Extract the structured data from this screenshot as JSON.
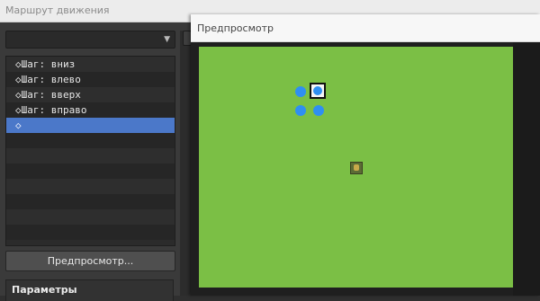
{
  "main_window": {
    "title": "Маршрут движения",
    "combo": {
      "value": "",
      "arrow": "▼"
    },
    "commands": [
      "◇Шаг: вниз",
      "◇Шаг: влево",
      "◇Шаг: вверх",
      "◇Шаг: вправо",
      "◇"
    ],
    "empty_rows": 7,
    "selected_index": 4,
    "preview_button": "Предпросмотр...",
    "params_header": "Параметры"
  },
  "preview_window": {
    "title": "Предпросмотр",
    "colors": {
      "grass": "#7bbf45",
      "route_dot": "#2f8ff2"
    },
    "route_dots": 4,
    "event_icon": "character-sprite-icon"
  }
}
